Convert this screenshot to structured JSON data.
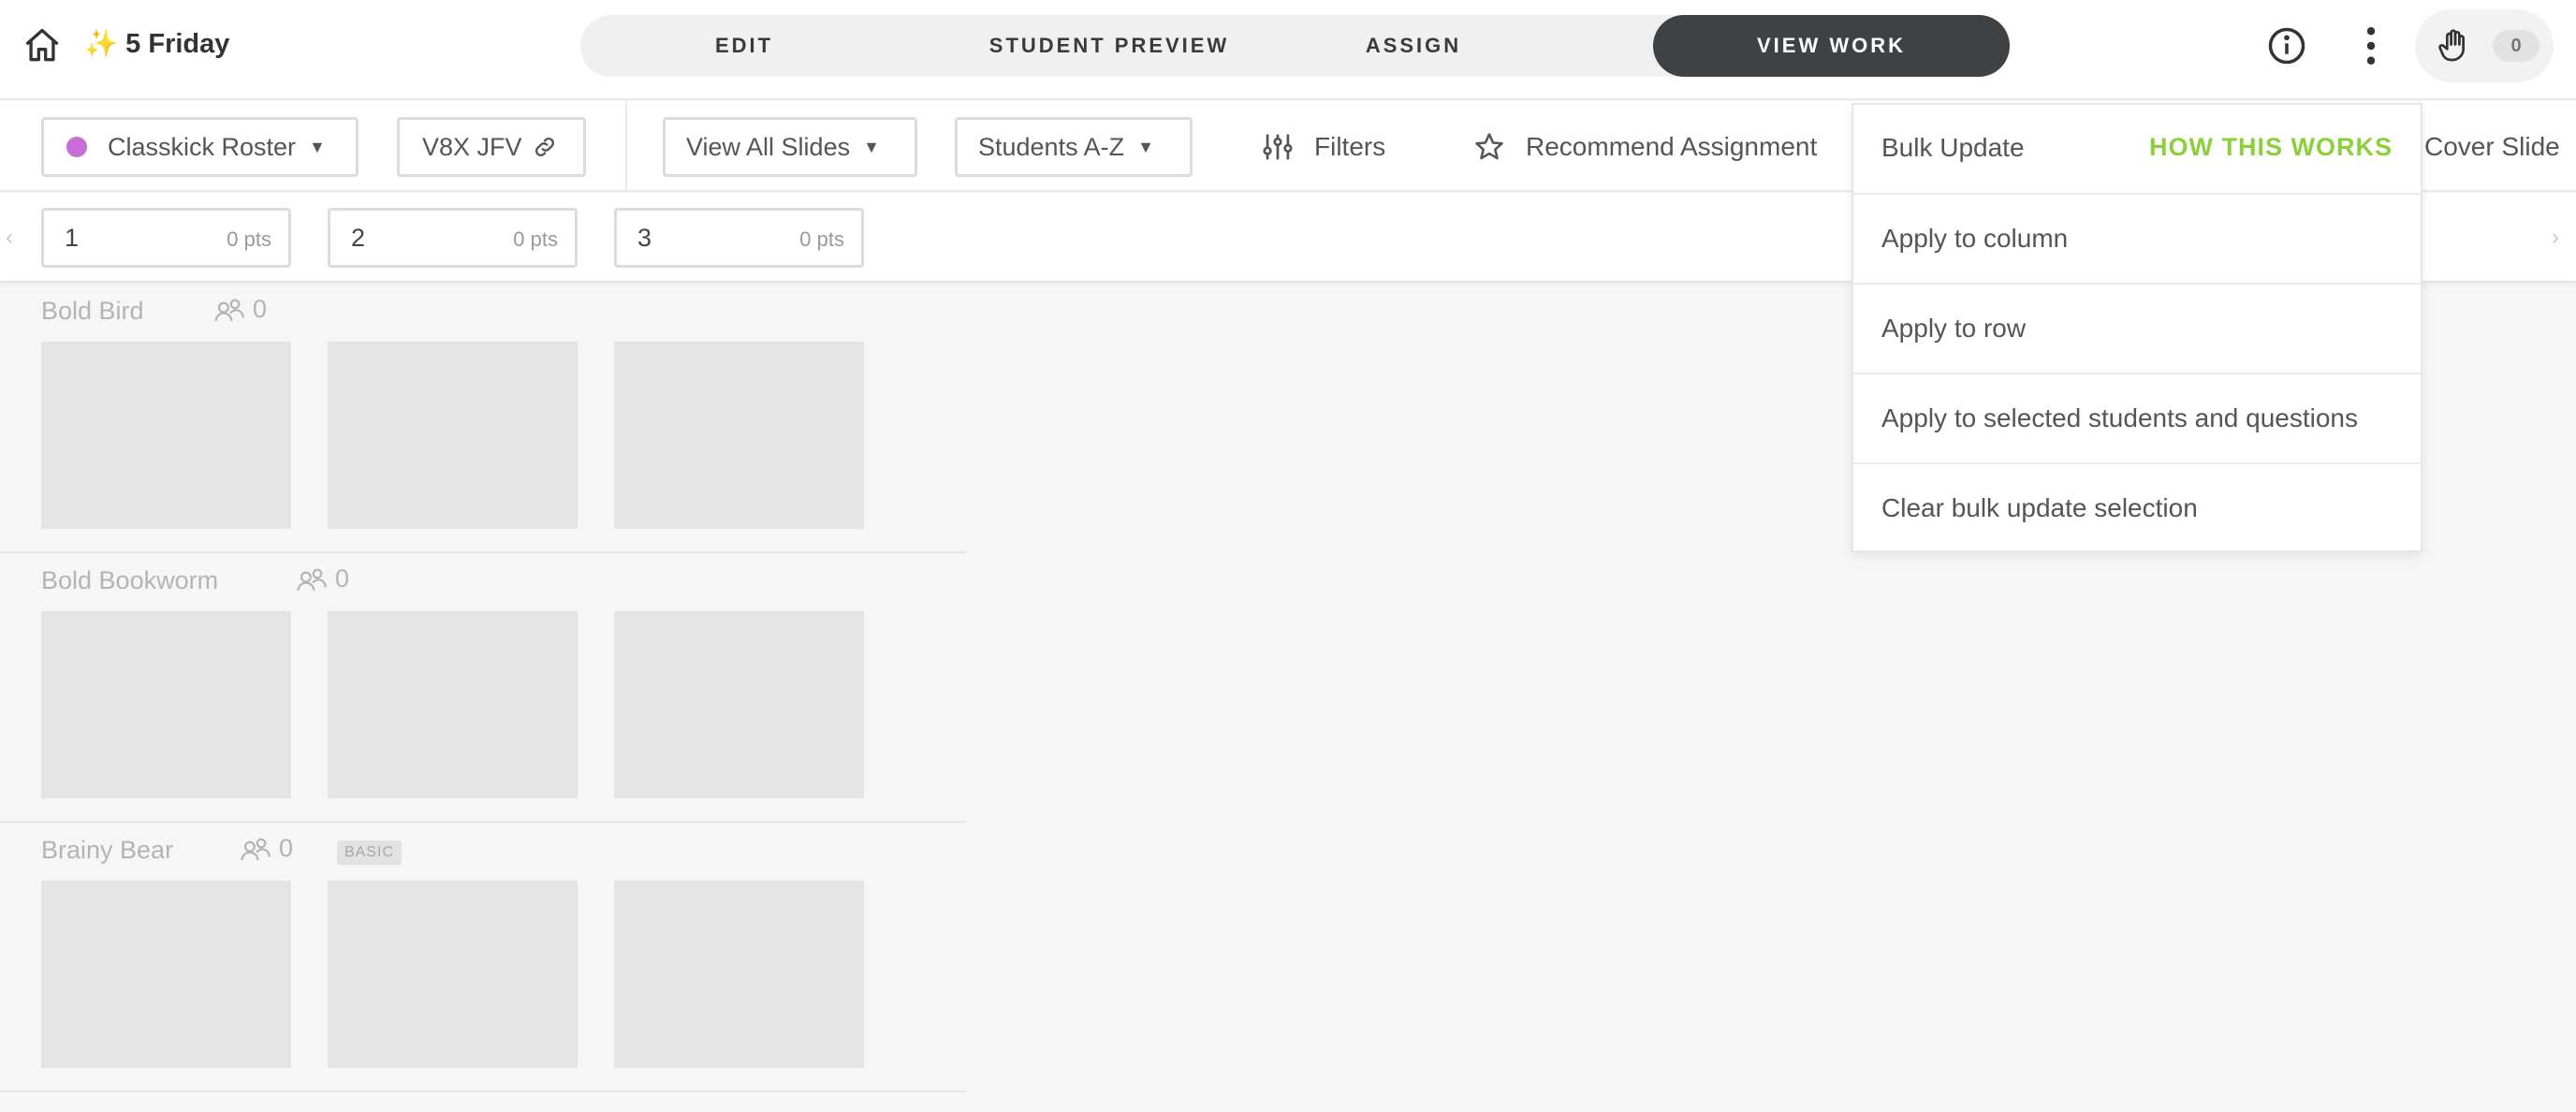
{
  "header": {
    "title": "✨ 5 Friday",
    "tabs": [
      {
        "label": "EDIT",
        "active": false
      },
      {
        "label": "STUDENT PREVIEW",
        "active": false
      },
      {
        "label": "ASSIGN",
        "active": false
      },
      {
        "label": "VIEW WORK",
        "active": true
      }
    ],
    "help_count": "0"
  },
  "toolbar": {
    "roster_label": "Classkick Roster",
    "roster_color": "#c86dd7",
    "code_label": "V8X JFV",
    "slides_select": "View All Slides",
    "sort_select": "Students A-Z",
    "filters_label": "Filters",
    "recommend_label": "Recommend Assignment",
    "cover_slide_label": "Cover Slide"
  },
  "questions": [
    {
      "number": "1",
      "points": "0 pts"
    },
    {
      "number": "2",
      "points": "0 pts"
    },
    {
      "number": "3",
      "points": "0 pts"
    }
  ],
  "students": [
    {
      "name": "Bold Bird",
      "helpers": "0",
      "badge": ""
    },
    {
      "name": "Bold Bookworm",
      "helpers": "0",
      "badge": ""
    },
    {
      "name": "Brainy Bear",
      "helpers": "0",
      "badge": "BASIC"
    }
  ],
  "bulk_menu": {
    "title": "Bulk Update",
    "link": "HOW THIS WORKS",
    "link_color": "#8bcf3b",
    "items": [
      "Apply to column",
      "Apply to row",
      "Apply to selected students and questions",
      "Clear bulk update selection"
    ]
  }
}
